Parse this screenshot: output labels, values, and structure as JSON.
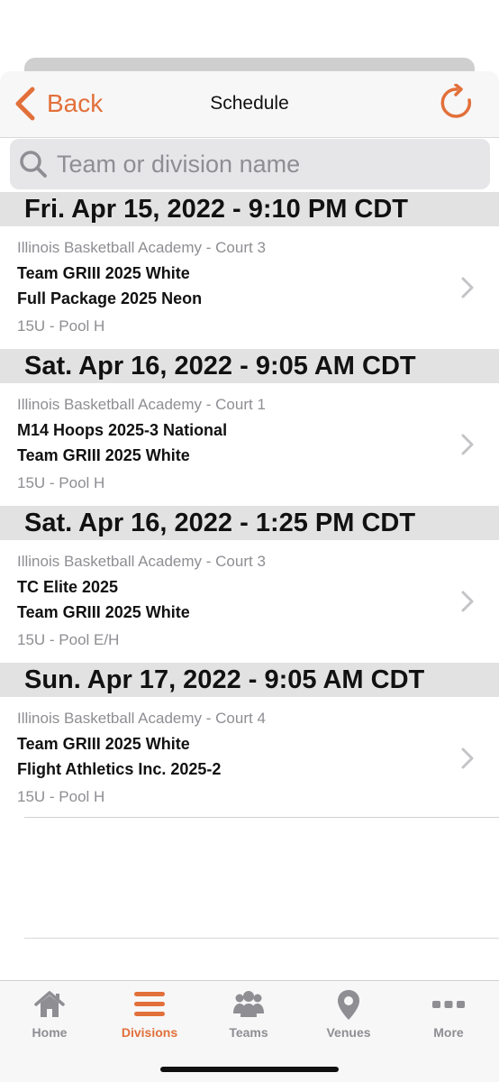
{
  "navbar": {
    "back_label": "Back",
    "title": "Schedule",
    "accent_color": "#e2703a"
  },
  "search": {
    "placeholder": "Team or division name"
  },
  "games": [
    {
      "date_header": "Fri. Apr 15, 2022 - 9:10 PM CDT",
      "venue": "Illinois Basketball Academy - Court 3",
      "team1": "Team GRIII 2025 White",
      "team2": "Full Package 2025 Neon",
      "division": "15U - Pool H"
    },
    {
      "date_header": "Sat. Apr 16, 2022 - 9:05 AM CDT",
      "venue": "Illinois Basketball Academy - Court 1",
      "team1": "M14 Hoops 2025-3 National",
      "team2": "Team GRIII 2025 White",
      "division": "15U - Pool H"
    },
    {
      "date_header": "Sat. Apr 16, 2022 - 1:25 PM CDT",
      "venue": "Illinois Basketball Academy - Court 3",
      "team1": "TC Elite 2025",
      "team2": "Team GRIII 2025 White",
      "division": "15U - Pool E/H"
    },
    {
      "date_header": "Sun. Apr 17, 2022 - 9:05 AM CDT",
      "venue": "Illinois Basketball Academy - Court 4",
      "team1": "Team GRIII 2025 White",
      "team2": "Flight Athletics Inc. 2025-2",
      "division": "15U - Pool H"
    }
  ],
  "tabbar": {
    "tabs": [
      {
        "label": "Home",
        "icon": "home-icon"
      },
      {
        "label": "Divisions",
        "icon": "list-icon",
        "active": true
      },
      {
        "label": "Teams",
        "icon": "people-icon"
      },
      {
        "label": "Venues",
        "icon": "map-pin-icon"
      },
      {
        "label": "More",
        "icon": "more-dots-icon"
      }
    ]
  }
}
